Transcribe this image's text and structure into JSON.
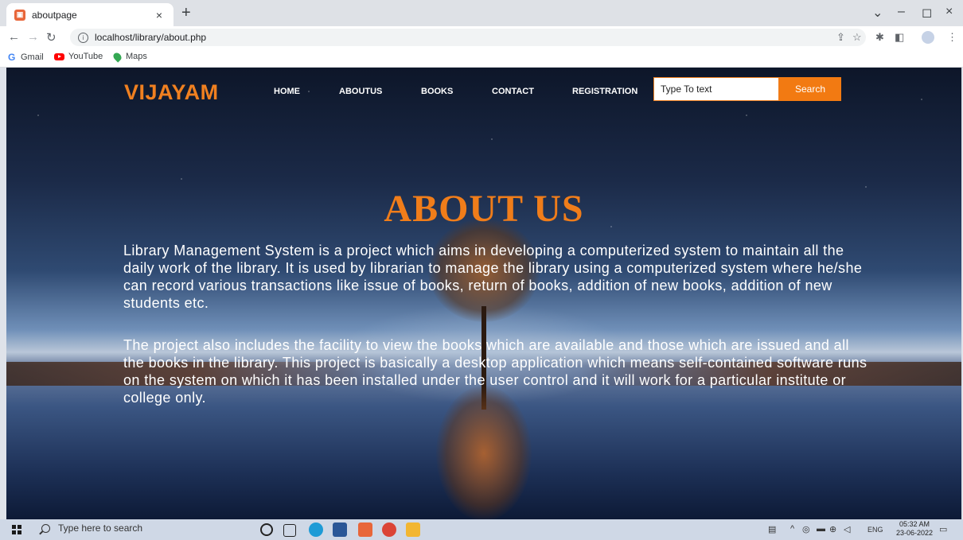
{
  "browser": {
    "tab_title": "aboutpage",
    "tab_close": "×",
    "new_tab": "+",
    "url": "localhost/library/about.php",
    "bookmarks": [
      {
        "label": "Gmail"
      },
      {
        "label": "YouTube"
      },
      {
        "label": "Maps"
      }
    ],
    "window_controls": {
      "chevron": "⌄",
      "minimize": "–",
      "maximize": "◻",
      "close": "×"
    }
  },
  "site": {
    "logo": "VIJAYAM",
    "nav": [
      "HOME",
      "ABOUTUS",
      "BOOKS",
      "CONTACT",
      "REGISTRATION"
    ],
    "search": {
      "placeholder": "Type To text",
      "button": "Search"
    },
    "heading": "ABOUT US",
    "paragraphs": [
      "Library Management System is a project which aims in developing a computerized system to maintain all the daily work of the library. It is used by librarian to manage the library using a computerized system where he/she can record various transactions like issue of books, return of books, addition of new books, addition of new students etc.",
      "The project also includes the facility to view the books which are available and those which are issued and all the books in the library. This project is basically a desktop application which means self-contained software runs on the system on which it has been installed under the user control and it will work for a particular institute or college only."
    ],
    "colors": {
      "accent": "#f08020",
      "button": "#f27a12",
      "text": "#ffffff"
    }
  },
  "taskbar": {
    "search_placeholder": "Type here to search",
    "language": "ENG",
    "time": "05:32 AM",
    "date": "23-06-2022"
  }
}
